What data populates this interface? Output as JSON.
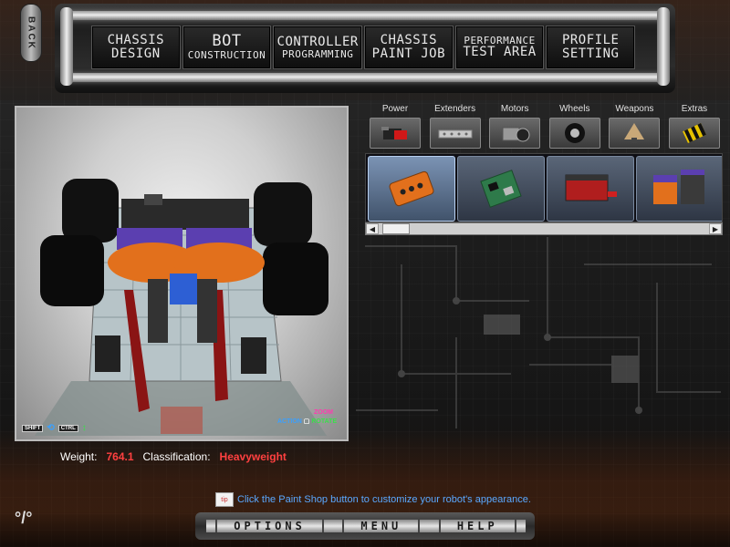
{
  "back": {
    "label": "BACK"
  },
  "nav": {
    "tabs": [
      {
        "line1": "CHASSIS",
        "line2": "DESIGN"
      },
      {
        "line1": "BOT",
        "line2": "CONSTRUCTION"
      },
      {
        "line1": "CONTROLLER",
        "line2": "PROGRAMMING"
      },
      {
        "line1": "CHASSIS",
        "line2": "PAINT JOB"
      },
      {
        "line1": "PERFORMANCE",
        "line2": "TEST AREA"
      },
      {
        "line1": "PROFILE",
        "line2": "SETTING"
      }
    ]
  },
  "viewport": {
    "controls": {
      "shift": "SHIFT",
      "ctrl": "CTRL"
    },
    "legend": {
      "zoom": "ZOOM",
      "action": "ACTION",
      "rotate": "ROTATE"
    }
  },
  "stats": {
    "weight_label": "Weight:",
    "weight_value": "764.1",
    "class_label": "Classification:",
    "class_value": "Heavyweight"
  },
  "categories": [
    {
      "label": "Power",
      "icon": "battery-icon"
    },
    {
      "label": "Extenders",
      "icon": "extender-bar-icon"
    },
    {
      "label": "Motors",
      "icon": "motor-icon"
    },
    {
      "label": "Wheels",
      "icon": "wheel-icon"
    },
    {
      "label": "Weapons",
      "icon": "weapon-icon"
    },
    {
      "label": "Extras",
      "icon": "hazard-icon"
    }
  ],
  "parts": [
    {
      "icon": "orange-battery-pack-icon",
      "selected": true
    },
    {
      "icon": "green-circuit-board-icon",
      "selected": false
    },
    {
      "icon": "red-battery-pack-icon",
      "selected": false
    },
    {
      "icon": "battery-stack-icon",
      "selected": false
    }
  ],
  "hint": {
    "icon_label": "tip",
    "text": "Click the Paint Shop button to customize your robot's appearance."
  },
  "bottom": {
    "options": "OPTIONS",
    "menu": "MENU",
    "help": "HELP"
  },
  "colors": {
    "accent_red": "#ff4040",
    "hint_blue": "#5aa8ff",
    "zoom_pink": "#ff3ab0",
    "rotate_green": "#3ae04a"
  }
}
